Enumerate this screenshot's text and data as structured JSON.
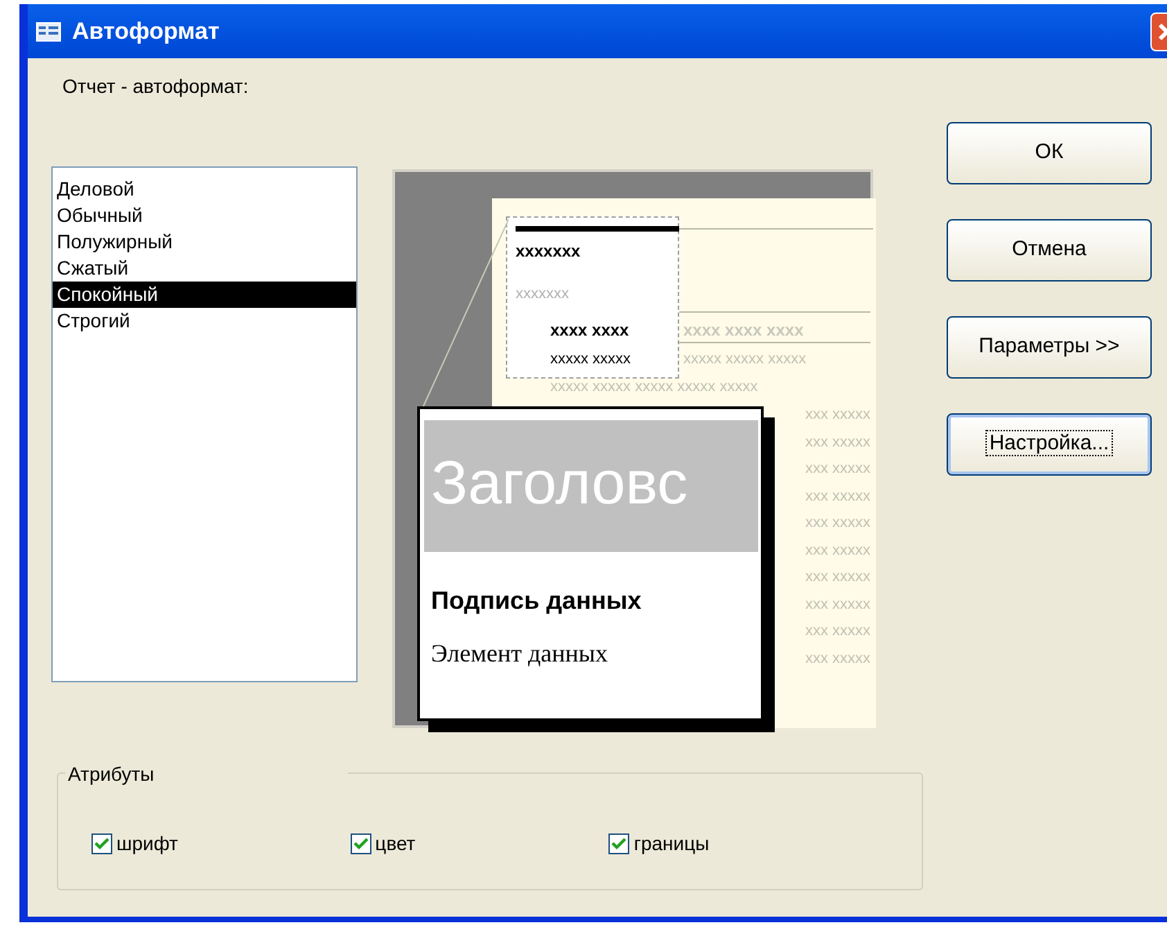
{
  "window": {
    "title": "Автоформат"
  },
  "list_label": "Отчет - автоформат:",
  "styles": [
    {
      "label": "Деловой",
      "selected": false
    },
    {
      "label": "Обычный",
      "selected": false
    },
    {
      "label": "Полужирный",
      "selected": false
    },
    {
      "label": "Сжатый",
      "selected": false
    },
    {
      "label": "Спокойный",
      "selected": true
    },
    {
      "label": "Строгий",
      "selected": false
    }
  ],
  "preview": {
    "report_title": "xxxxxxx",
    "report_subtitle": "xxxxxxx",
    "header_left": "xxxx xxxx",
    "header_right": "xxxx xxxx xxxx",
    "first_row_left": "xxxxx xxxxx",
    "first_row_right": "xxxxx xxxxx xxxxx",
    "second_row": "xxxxx xxxxx xxxxx xxxxx xxxxx",
    "covered_rows": [
      "xxx xxxxx",
      "xxx xxxxx",
      "xxx xxxxx",
      "xxx xxxxx",
      "xxx xxxxx",
      "xxx xxxxx",
      "xxx xxxxx",
      "xxx xxxxx",
      "xxx xxxxx",
      "xxx xxxxx"
    ],
    "callout": {
      "heading": "Заголовс",
      "label": "Подпись данных",
      "field": "Элемент данных"
    }
  },
  "buttons": [
    {
      "label": "ОК",
      "focused": false
    },
    {
      "label": "Отмена",
      "focused": false
    },
    {
      "label": "Параметры >>",
      "focused": false
    },
    {
      "label": "Настройка...",
      "focused": true
    }
  ],
  "attributes": {
    "title": "Атрибуты",
    "options": [
      {
        "label": "шрифт",
        "checked": true
      },
      {
        "label": "цвет",
        "checked": true
      },
      {
        "label": "границы",
        "checked": true
      }
    ]
  }
}
